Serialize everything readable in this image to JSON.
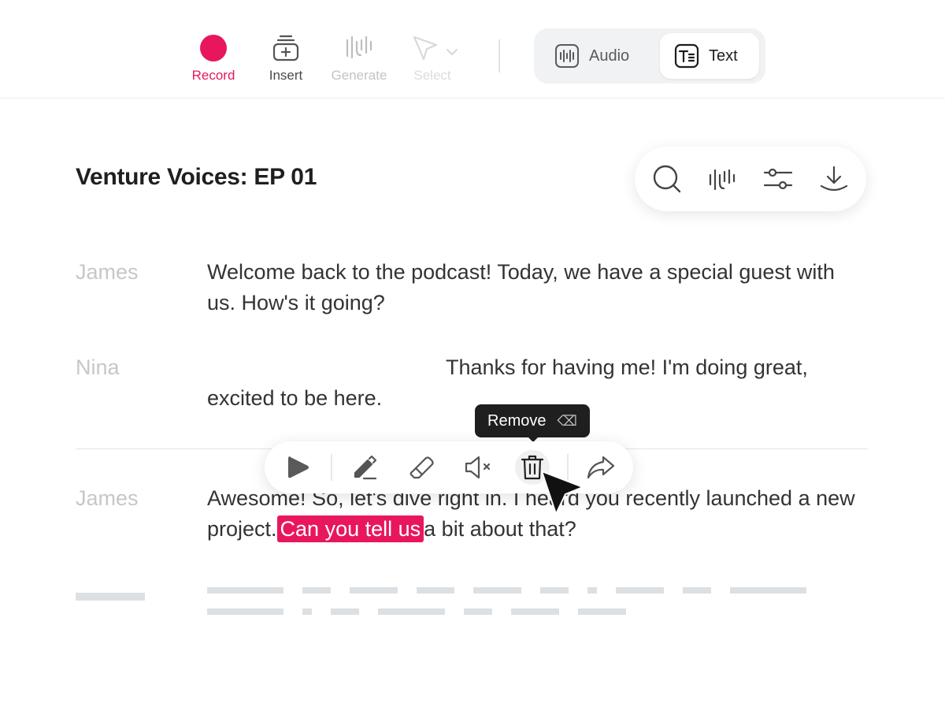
{
  "toolbar": {
    "tools": [
      {
        "label": "Record"
      },
      {
        "label": "Insert"
      },
      {
        "label": "Generate"
      },
      {
        "label": "Select"
      }
    ],
    "modes": [
      {
        "label": "Audio",
        "icon": "waveform-icon"
      },
      {
        "label": "Text",
        "icon": "text-icon"
      }
    ],
    "active_mode": "Text"
  },
  "document": {
    "title": "Venture Voices: EP 01",
    "actions": [
      "search-icon",
      "waveform-icon",
      "sliders-icon",
      "download-icon"
    ]
  },
  "transcript": [
    {
      "speaker": "James",
      "lines": [
        "Welcome back to the podcast! Today, we have a special guest with",
        "us. How's it going?"
      ]
    },
    {
      "speaker": "Nina",
      "lines": [
        "Thanks for having me! I'm doing great,",
        "excited to be here."
      ]
    },
    {
      "speaker": "James",
      "line1": "Awesome! So, let's dive right in. I heard you recently launched a new",
      "line2_before": "project.",
      "line2_highlight": "Can you tell us",
      "line2_after": "a bit about that?"
    }
  ],
  "edit_bar": {
    "tools": [
      "play-icon",
      "pencil-icon",
      "eraser-icon",
      "mute-icon",
      "trash-icon",
      "share-icon"
    ],
    "tooltip": "Remove",
    "tooltip_shortcut": "⌫"
  },
  "colors": {
    "accent": "#e8175d",
    "tooltip_bg": "#1f1f1f"
  }
}
